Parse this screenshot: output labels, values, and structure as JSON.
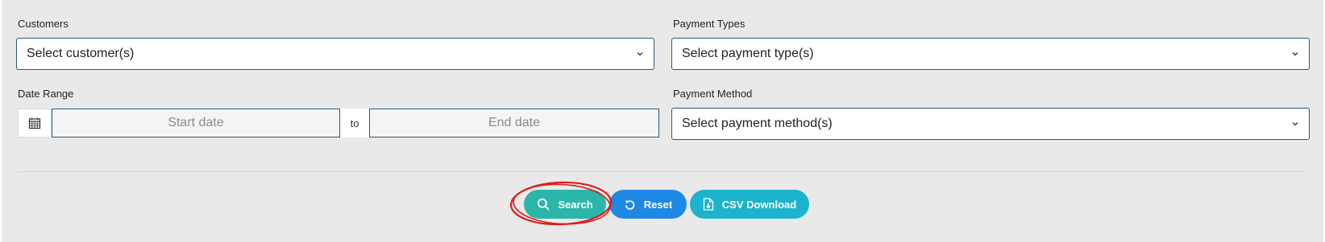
{
  "filters": {
    "customers": {
      "label": "Customers",
      "placeholder": "Select customer(s)"
    },
    "payment_types": {
      "label": "Payment Types",
      "placeholder": "Select payment type(s)"
    },
    "date_range": {
      "label": "Date Range",
      "start_placeholder": "Start date",
      "separator": "to",
      "end_placeholder": "End date"
    },
    "payment_method": {
      "label": "Payment Method",
      "placeholder": "Select payment method(s)"
    }
  },
  "actions": {
    "search_label": "Search",
    "reset_label": "Reset",
    "csv_label": "CSV Download"
  },
  "icons": {
    "dropdown": "chevron-down-icon",
    "calendar": "calendar-icon",
    "search": "search-icon",
    "reset": "reset-icon",
    "csv": "file-download-icon"
  },
  "colors": {
    "panel_background": "#e9e9e9",
    "input_border": "#2a5b7a",
    "search_button": "#2ab6a9",
    "reset_button": "#1e88e5",
    "csv_button": "#1cb3cc",
    "annotation": "#e01b1b"
  }
}
